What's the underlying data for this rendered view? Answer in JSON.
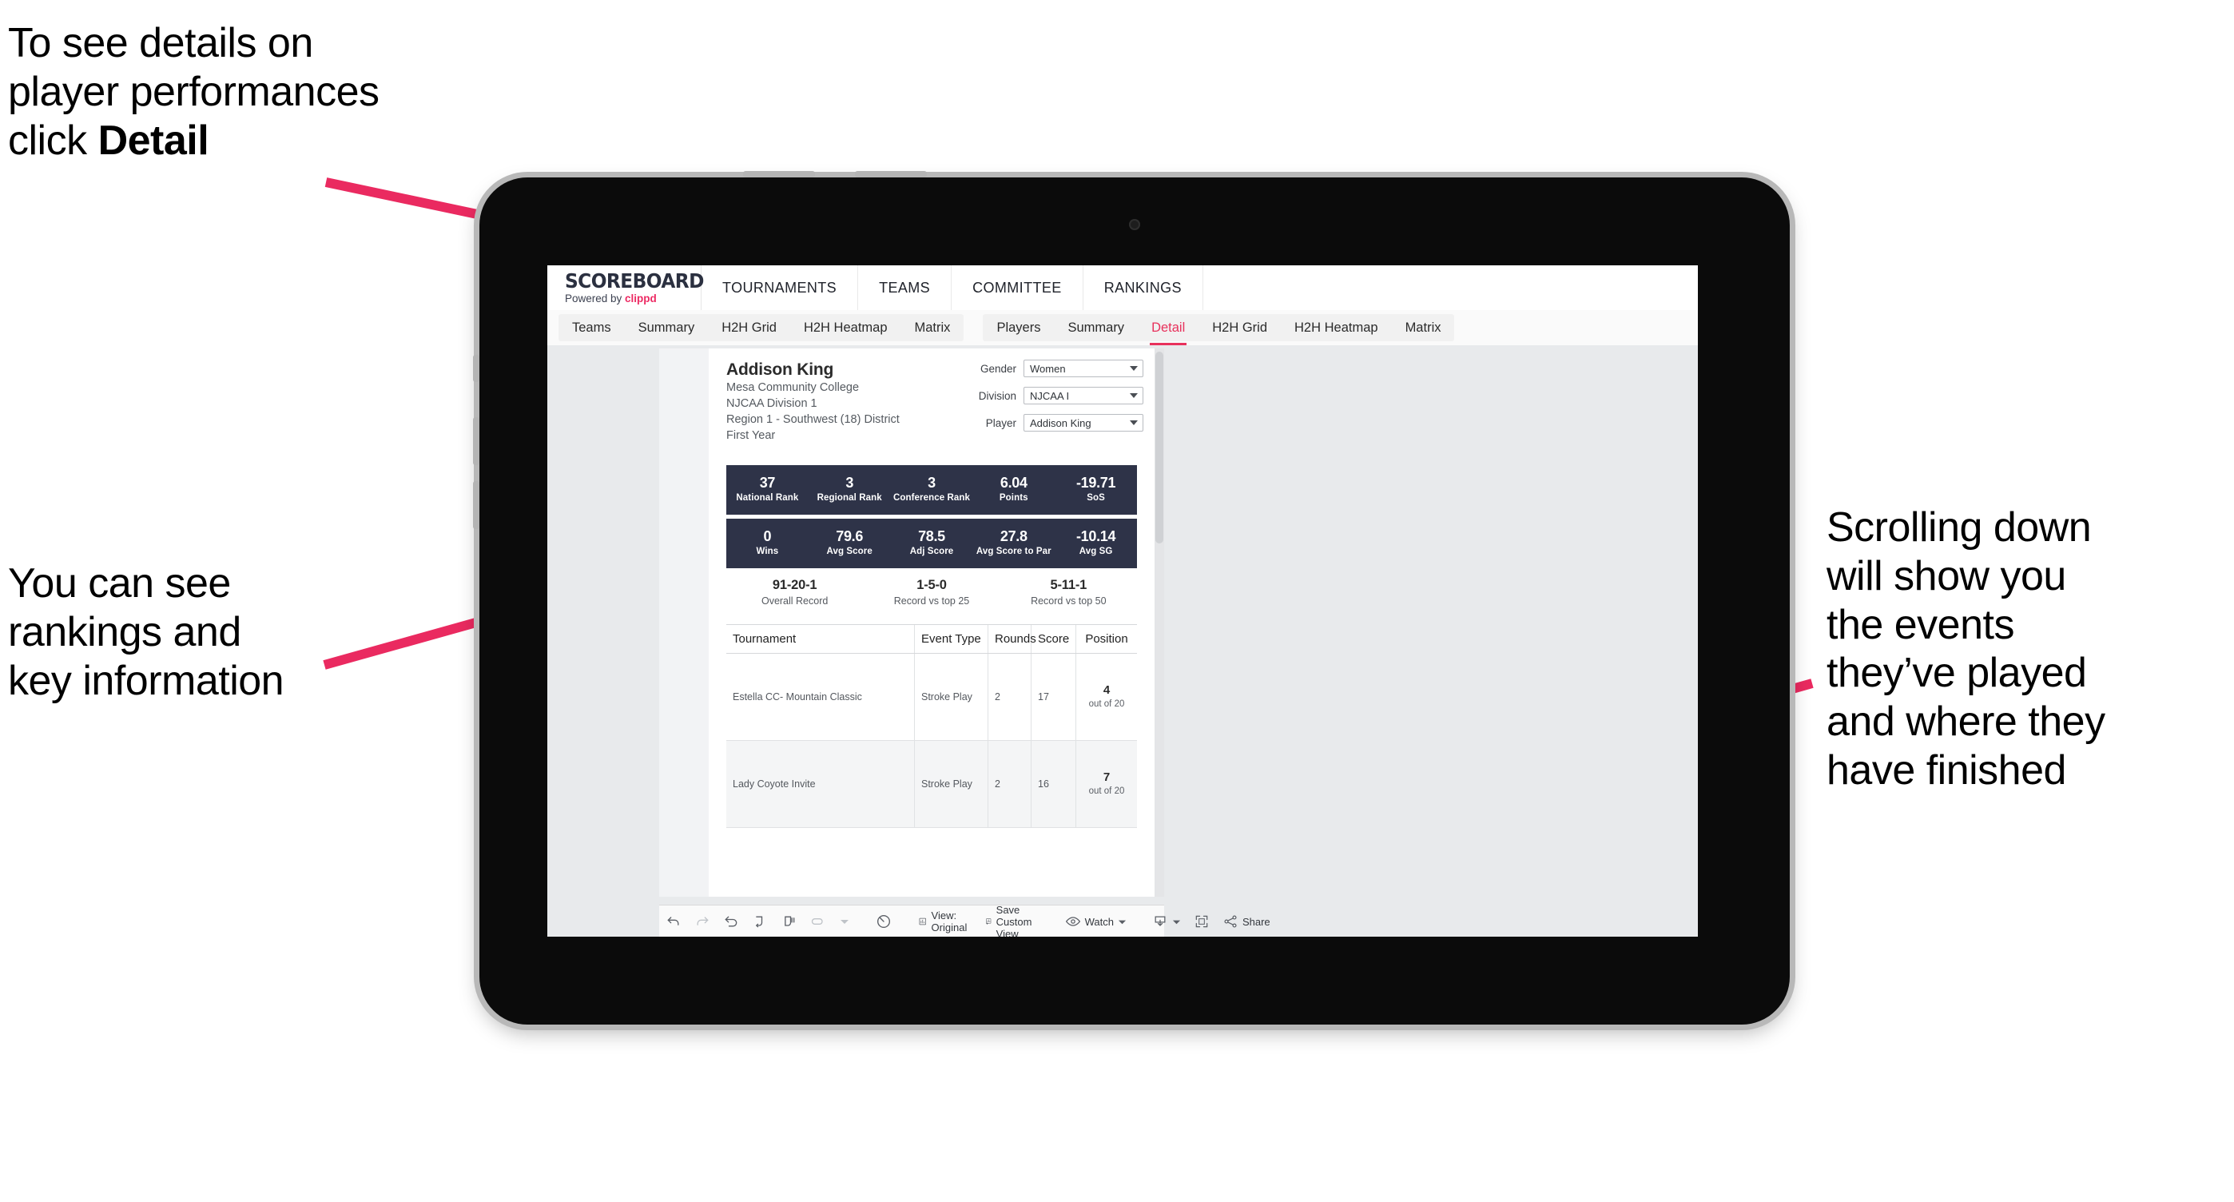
{
  "annotations": [
    {
      "id": "detail",
      "text": "To see details on\nplayer performances\nclick ",
      "bold": "Detail"
    },
    {
      "id": "rankings",
      "text": "You can see\nrankings and\nkey information",
      "bold": ""
    },
    {
      "id": "scroll",
      "text": "Scrolling down\nwill show you\nthe events\nthey’ve played\nand where they\nhave finished",
      "bold": ""
    }
  ],
  "accent_color": "#e8315c",
  "arrow_color": "#ea2a60",
  "app": {
    "brand": {
      "title": "SCOREBOARD",
      "powered_prefix": "Powered by ",
      "powered_name": "clippd"
    },
    "topnav": [
      "TOURNAMENTS",
      "TEAMS",
      "COMMITTEE",
      "RANKINGS"
    ],
    "teams_tabs": [
      "Teams",
      "Summary",
      "H2H Grid",
      "H2H Heatmap",
      "Matrix"
    ],
    "players_tabs": [
      "Players",
      "Summary",
      "Detail",
      "H2H Grid",
      "H2H Heatmap",
      "Matrix"
    ],
    "active_tab": "Detail"
  },
  "player": {
    "name": "Addison King",
    "meta": [
      "Mesa Community College",
      "NJCAA Division 1",
      "Region 1 - Southwest (18) District",
      "First Year"
    ]
  },
  "filters": [
    {
      "label": "Gender",
      "value": "Women"
    },
    {
      "label": "Division",
      "value": "NJCAA I"
    },
    {
      "label": "Player",
      "value": "Addison King"
    }
  ],
  "stats_row1": [
    {
      "value": "37",
      "label": "National Rank"
    },
    {
      "value": "3",
      "label": "Regional Rank"
    },
    {
      "value": "3",
      "label": "Conference Rank"
    },
    {
      "value": "6.04",
      "label": "Points"
    },
    {
      "value": "-19.71",
      "label": "SoS"
    }
  ],
  "stats_row2": [
    {
      "value": "0",
      "label": "Wins"
    },
    {
      "value": "79.6",
      "label": "Avg Score"
    },
    {
      "value": "78.5",
      "label": "Adj Score"
    },
    {
      "value": "27.8",
      "label": "Avg Score to Par"
    },
    {
      "value": "-10.14",
      "label": "Avg SG"
    }
  ],
  "records": [
    {
      "value": "91-20-1",
      "label": "Overall Record"
    },
    {
      "value": "1-5-0",
      "label": "Record vs top 25"
    },
    {
      "value": "5-11-1",
      "label": "Record vs top 50"
    }
  ],
  "table": {
    "headers": [
      "Tournament",
      "Event Type",
      "Rounds",
      "Score",
      "Position"
    ],
    "rows": [
      {
        "tournament": "Estella CC- Mountain Classic",
        "event_type": "Stroke Play",
        "rounds": "2",
        "score": "17",
        "position": "4",
        "position_sub": "out of 20"
      },
      {
        "tournament": "Lady Coyote Invite",
        "event_type": "Stroke Play",
        "rounds": "2",
        "score": "16",
        "position": "7",
        "position_sub": "out of 20"
      }
    ]
  },
  "toolbar": {
    "view_label": "View: Original",
    "save_label": "Save Custom View",
    "watch_label": "Watch",
    "share_label": "Share"
  }
}
